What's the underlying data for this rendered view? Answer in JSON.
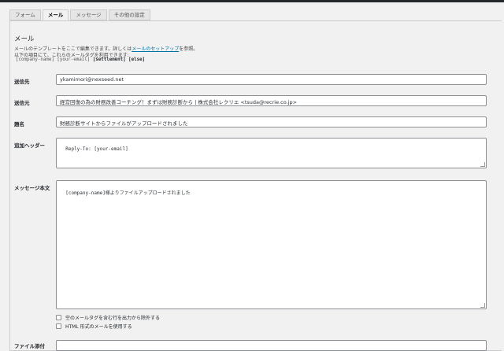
{
  "tabs": [
    {
      "label": "フォーム"
    },
    {
      "label": "メール"
    },
    {
      "label": "メッセージ"
    },
    {
      "label": "その他の設定"
    }
  ],
  "mail": {
    "title": "メール",
    "desc1_prefix": "メールのテンプレートをここで編集できます。詳しくは",
    "desc1_link": "メールのセットアップ",
    "desc1_suffix": "を参照。",
    "desc2": "以下の項目にて、これらのメールタグを利用できます:",
    "tag_company": "[company-name]",
    "tag_email": "[your-email]",
    "tag_settlement": "[settlement]",
    "tag_else": "[else]",
    "to_label": "送信先",
    "to_value": "ykamimori@nexseed.net",
    "from_label": "送信元",
    "from_value": "経営回復の為の財務改善コーチング！まずは財務診断から | 株式会社レクリエ <tsuda@recrie.co.jp>",
    "subject_label": "題名",
    "subject_value": "財務診断サイトからファイルがアップロードされました",
    "headers_label": "追加ヘッダー",
    "headers_value": "Reply-To: [your-email]",
    "body_label": "メッセージ本文",
    "body_value": "[company-name]様よりファイルアップロードされました",
    "exclude_blank_label": "空のメールタグを含む行を出力から除外する",
    "html_mail_label": "HTML 形式のメールを使用する",
    "next_label": "ファイル添付"
  }
}
